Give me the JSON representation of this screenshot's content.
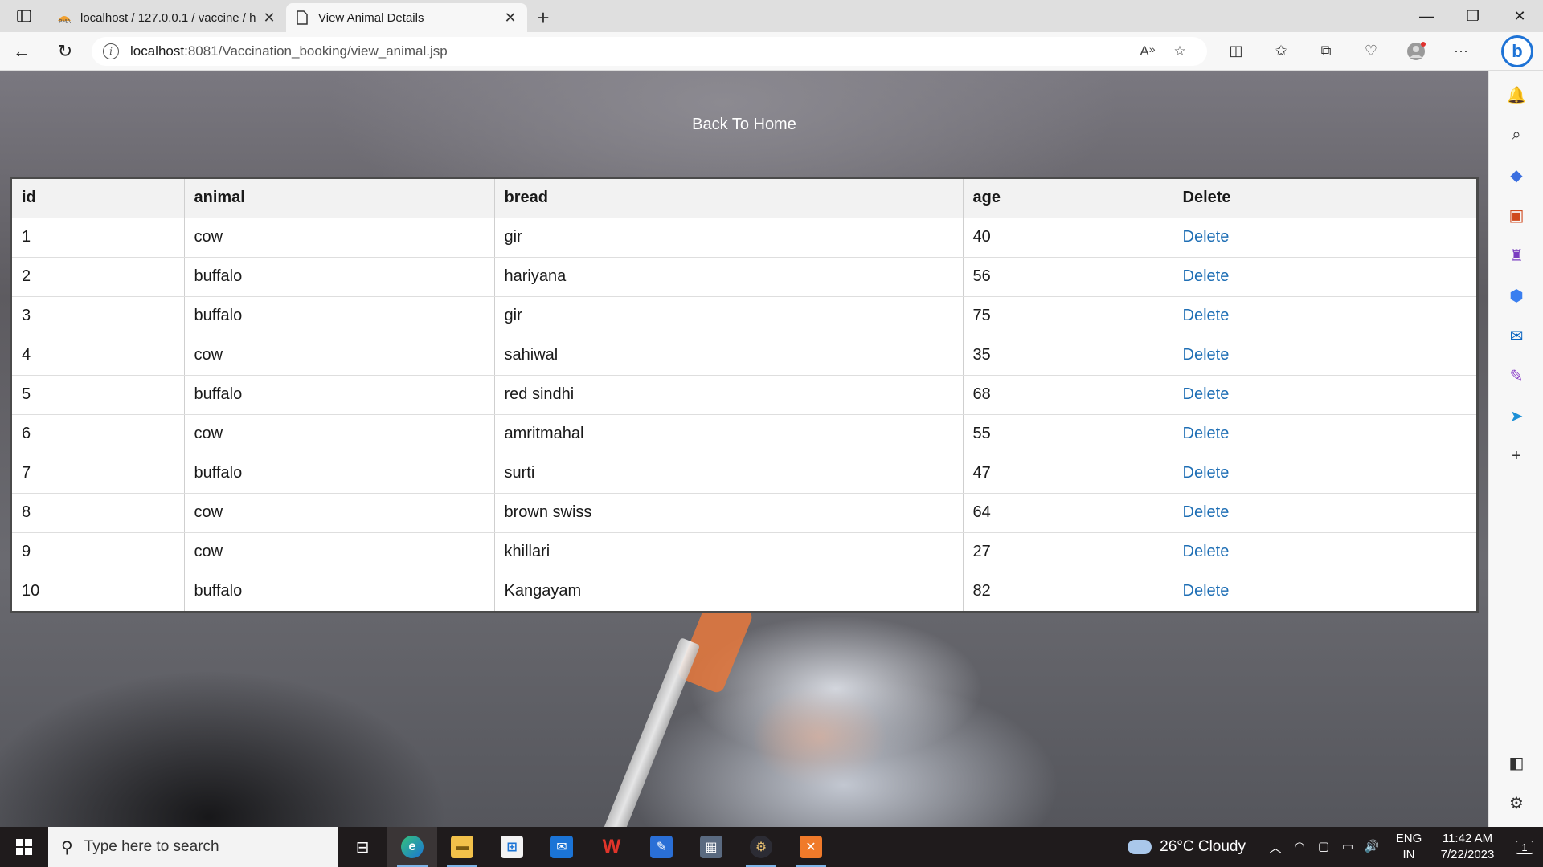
{
  "browser": {
    "tabs": [
      {
        "title": "localhost / 127.0.0.1 / vaccine / h",
        "favicon": "phpmyadmin-icon",
        "active": false
      },
      {
        "title": "View Animal Details",
        "favicon": "page-icon",
        "active": true
      }
    ],
    "url_host": "localhost",
    "url_rest": ":8081/Vaccination_booking/view_animal.jsp"
  },
  "page": {
    "back_link": "Back To Home",
    "table": {
      "headers": [
        "id",
        "animal",
        "bread",
        "age",
        "Delete"
      ],
      "rows": [
        {
          "id": "1",
          "animal": "cow",
          "bread": "gir",
          "age": "40",
          "action": "Delete"
        },
        {
          "id": "2",
          "animal": "buffalo",
          "bread": "hariyana",
          "age": "56",
          "action": "Delete"
        },
        {
          "id": "3",
          "animal": "buffalo",
          "bread": "gir",
          "age": "75",
          "action": "Delete"
        },
        {
          "id": "4",
          "animal": "cow",
          "bread": "sahiwal",
          "age": "35",
          "action": "Delete"
        },
        {
          "id": "5",
          "animal": "buffalo",
          "bread": "red sindhi",
          "age": "68",
          "action": "Delete"
        },
        {
          "id": "6",
          "animal": "cow",
          "bread": "amritmahal",
          "age": "55",
          "action": "Delete"
        },
        {
          "id": "7",
          "animal": "buffalo",
          "bread": "surti",
          "age": "47",
          "action": "Delete"
        },
        {
          "id": "8",
          "animal": "cow",
          "bread": "brown swiss",
          "age": "64",
          "action": "Delete"
        },
        {
          "id": "9",
          "animal": "cow",
          "bread": "khillari",
          "age": "27",
          "action": "Delete"
        },
        {
          "id": "10",
          "animal": "buffalo",
          "bread": "Kangayam",
          "age": "82",
          "action": "Delete"
        }
      ]
    },
    "link_color": "#1f6fb5"
  },
  "taskbar": {
    "search_placeholder": "Type here to search",
    "weather": "26°C  Cloudy",
    "lang_top": "ENG",
    "lang_bottom": "IN",
    "time": "11:42 AM",
    "date": "7/22/2023",
    "notification_count": "1"
  }
}
